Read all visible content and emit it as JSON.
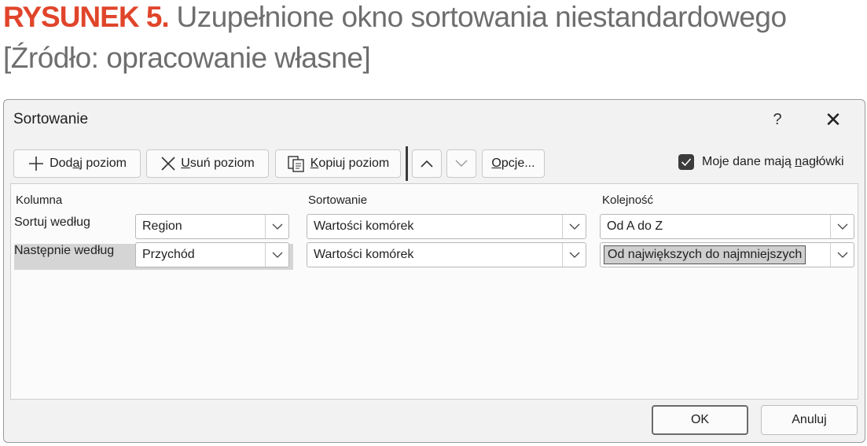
{
  "caption": {
    "label": "RYSUNEK 5.",
    "title": "Uzupełnione okno sortowania niestandardowego",
    "source": "[Źródło: opracowanie własne]"
  },
  "dialog": {
    "title": "Sortowanie",
    "help": "?",
    "close": "✕"
  },
  "toolbar": {
    "add_pre": "Dod",
    "add_ul": "a",
    "add_post": "j poziom",
    "del_pre": "",
    "del_ul": "U",
    "del_post": "suń poziom",
    "copy_pre": "",
    "copy_ul": "K",
    "copy_post": "opiuj poziom",
    "opts_pre": "",
    "opts_ul": "O",
    "opts_post": "pcje...",
    "headers_pre": "Moje dane mają ",
    "headers_ul": "n",
    "headers_post": "agłówki",
    "headers_checked": true
  },
  "table": {
    "columns": [
      "Kolumna",
      "Sortowanie",
      "Kolejność"
    ],
    "rows": [
      {
        "label": "Sortuj według",
        "column": "Region",
        "sort_on": "Wartości komórek",
        "order": "Od A do Z"
      },
      {
        "label": "Następnie według",
        "column": "Przychód",
        "sort_on": "Wartości komórek",
        "order": "Od największych do najmniejszych"
      }
    ]
  },
  "footer": {
    "ok": "OK",
    "cancel": "Anuluj"
  },
  "colors": {
    "caption_label": "#e0452b",
    "caption_text": "#6e6e6e",
    "selected_row": "#d5d5d5"
  }
}
